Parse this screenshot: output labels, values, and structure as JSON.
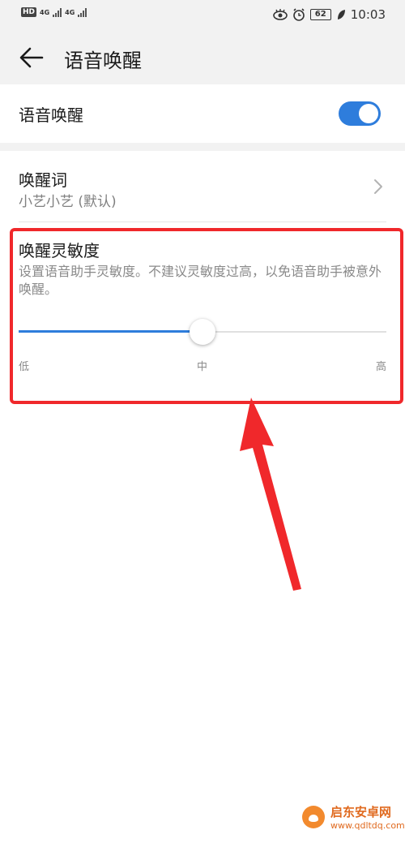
{
  "status_bar": {
    "hd": "HD",
    "net1": "4G",
    "net2": "4G",
    "battery": "62",
    "time": "10:03"
  },
  "header": {
    "title": "语音唤醒"
  },
  "voice_wake": {
    "label": "语音唤醒",
    "enabled": true
  },
  "wake_word": {
    "label": "唤醒词",
    "value": "小艺小艺 (默认)"
  },
  "sensitivity": {
    "title": "唤醒灵敏度",
    "description": "设置语音助手灵敏度。不建议灵敏度过高，以免语音助手被意外唤醒。",
    "level": 0.5,
    "ticks": [
      "低",
      "中",
      "高"
    ]
  },
  "watermark": {
    "name": "启东安卓网",
    "url": "www.qdltdq.com"
  },
  "colors": {
    "accent": "#2e7ddc",
    "annotation": "#f0282b"
  }
}
